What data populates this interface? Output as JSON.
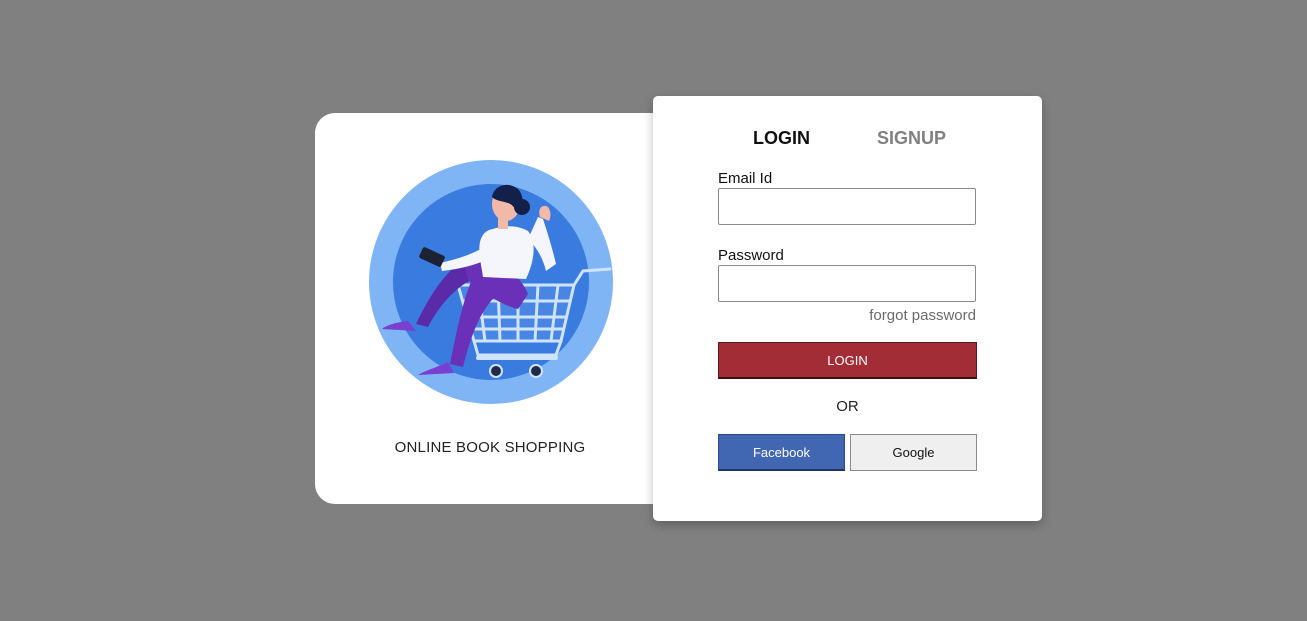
{
  "brand": {
    "caption": "ONLINE BOOK SHOPPING",
    "illustration": "woman-in-shopping-cart-illustration"
  },
  "auth": {
    "tabs": {
      "login": "LOGIN",
      "signup": "SIGNUP"
    },
    "email": {
      "label": "Email Id",
      "value": "",
      "placeholder": ""
    },
    "password": {
      "label": "Password",
      "value": "",
      "placeholder": ""
    },
    "forgot_label": "forgot password",
    "login_button": "LOGIN",
    "or_text": "OR",
    "social": {
      "facebook_label": "Facebook",
      "google_label": "Google"
    }
  },
  "colors": {
    "background": "#808080",
    "login_button": "#a32d36",
    "facebook_button": "#4267b2",
    "google_button": "#efefef",
    "illustration_outer": "#7fb5f5",
    "illustration_inner": "#3a7be0"
  }
}
